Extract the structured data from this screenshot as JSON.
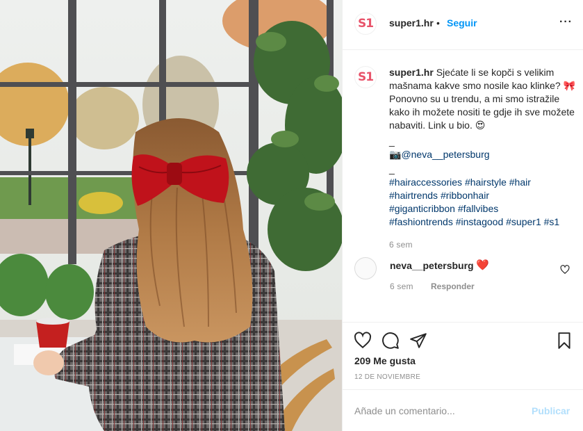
{
  "header": {
    "avatar_text": "S1",
    "username": "super1.hr",
    "separator": "•",
    "follow_label": "Seguir",
    "more_label": "···"
  },
  "caption": {
    "avatar_text": "S1",
    "username": "super1.hr",
    "line1": "Sjećate li se kopči s velikim mašnama kakve smo nosile kao klinke?",
    "bow_emoji": "🎀",
    "line2": "Ponovno su u trendu, a mi smo istražile kako ih možete nositi te gdje ih sve možete nabaviti. Link u bio.",
    "heart_face_emoji": "😍",
    "dash1": "_",
    "camera_emoji": "📷",
    "mention": "@neva__petersburg",
    "dash2": "_",
    "hashtags": [
      "#hairaccessories",
      "#hairstyle",
      "#hair",
      "#hairtrends",
      "#ribbonhair",
      "#giganticribbon",
      "#fallvibes",
      "#fashiontrends",
      "#instagood",
      "#super1",
      "#s1"
    ],
    "time": "6 sem"
  },
  "comment": {
    "username": "neva__petersburg",
    "text": "❤️",
    "time": "6 sem",
    "reply_label": "Responder"
  },
  "actions": {
    "likes": "209 Me gusta",
    "date": "12 DE NOVIEMBRE"
  },
  "add_comment": {
    "placeholder": "Añade un comentario...",
    "publish_label": "Publicar"
  },
  "colors": {
    "brand_pink": "#e8536a",
    "follow_blue": "#0095f6",
    "link_blue": "#00376b",
    "publish_disabled": "#b2dffc",
    "heart_red": "#e0242f"
  },
  "icons": [
    "more-icon",
    "heart-icon",
    "comment-icon",
    "share-icon",
    "bookmark-icon",
    "comment-like-icon"
  ]
}
